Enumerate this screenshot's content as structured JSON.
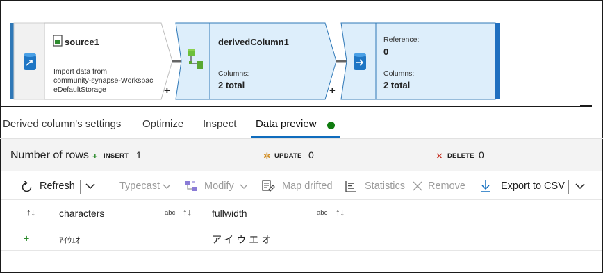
{
  "flow": {
    "source": {
      "title": "source1",
      "description_line1": "Import data from",
      "description_line2": "community-synapse-Workspac",
      "description_line3": "eDefaultStorage",
      "plus": "+"
    },
    "derived": {
      "title": "derivedColumn1",
      "columns_label": "Columns:",
      "columns_value": "2 total",
      "plus": "+"
    },
    "sink": {
      "reference_label": "Reference:",
      "reference_value": "0",
      "columns_label": "Columns:",
      "columns_value": "2 total"
    }
  },
  "tabs": [
    {
      "label": "Derived column's settings"
    },
    {
      "label": "Optimize"
    },
    {
      "label": "Inspect"
    },
    {
      "label": "Data preview"
    }
  ],
  "counts": {
    "label": "Number of rows",
    "insert": {
      "icon": "+",
      "tag": "INSERT",
      "value": "1"
    },
    "update": {
      "icon": "✲",
      "tag": "UPDATE",
      "value": "0"
    },
    "delete": {
      "icon": "✕",
      "tag": "DELETE",
      "value": "0"
    }
  },
  "toolbar": {
    "refresh": "Refresh",
    "typecast": "Typecast",
    "modify": "Modify",
    "map_drifted": "Map drifted",
    "statistics": "Statistics",
    "remove": "Remove",
    "export": "Export to CSV"
  },
  "grid": {
    "columns": [
      {
        "name": "characters",
        "type": "abc"
      },
      {
        "name": "fullwidth",
        "type": "abc"
      }
    ],
    "rows": [
      {
        "marker": "+",
        "characters": "ｱｲｳｴｵ",
        "fullwidth": "アイウエオ"
      }
    ]
  },
  "colors": {
    "accent": "#0f6cbd",
    "node_fill": "#ddeefb",
    "node_stroke": "#2f78b7",
    "status_ok": "#107c10",
    "insert": "#2a8a2a",
    "update": "#d08a1c",
    "delete": "#c42b1c"
  }
}
